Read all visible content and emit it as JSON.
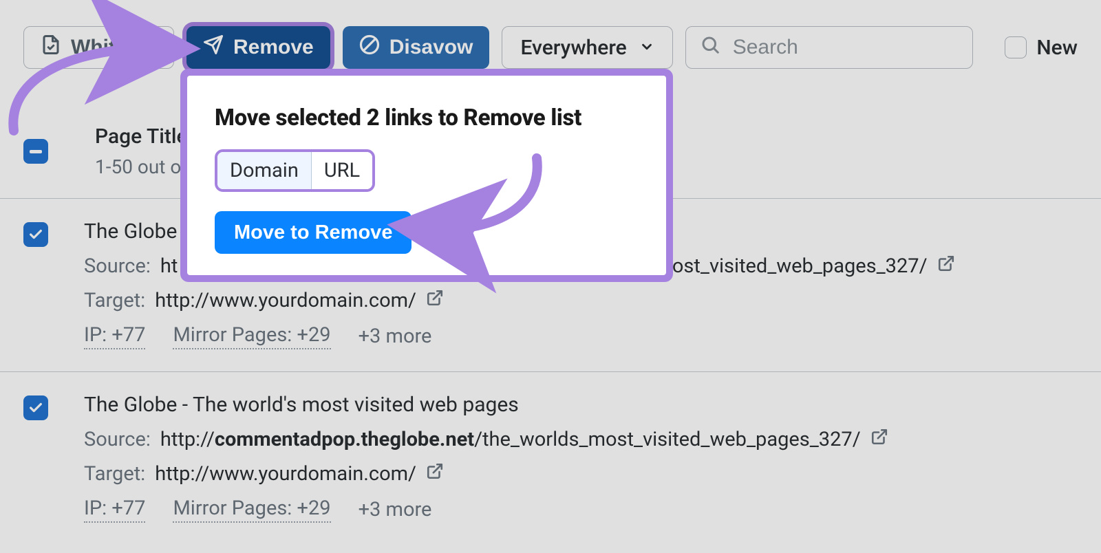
{
  "toolbar": {
    "whitelist_label": "Whitelist",
    "remove_label": "Remove",
    "disavow_label": "Disavow",
    "scope_label": "Everywhere",
    "search_placeholder": "Search",
    "new_label": "New"
  },
  "table_header": {
    "title": "Page Title",
    "range": "1-50 out of"
  },
  "rows": [
    {
      "title": "The Globe",
      "source_label": "Source:",
      "source_prefix": "ht",
      "source_suffix": "_most_visited_web_pages_327/",
      "target_label": "Target:",
      "target_url": "http://www.yourdomain.com/",
      "ip": "IP: +77",
      "mirror": "Mirror Pages: +29",
      "more": "+3 more"
    },
    {
      "title": "The Globe - The world's most visited web pages",
      "source_label": "Source:",
      "source_prefix": "http://",
      "source_bold": "commentadpop.theglobe.net",
      "source_suffix": "/the_worlds_most_visited_web_pages_327/",
      "target_label": "Target:",
      "target_url": "http://www.yourdomain.com/",
      "ip": "IP: +77",
      "mirror": "Mirror Pages: +29",
      "more": "+3 more"
    }
  ],
  "modal": {
    "title": "Move selected 2 links to Remove list",
    "seg_domain": "Domain",
    "seg_url": "URL",
    "confirm_label": "Move to Remove"
  }
}
